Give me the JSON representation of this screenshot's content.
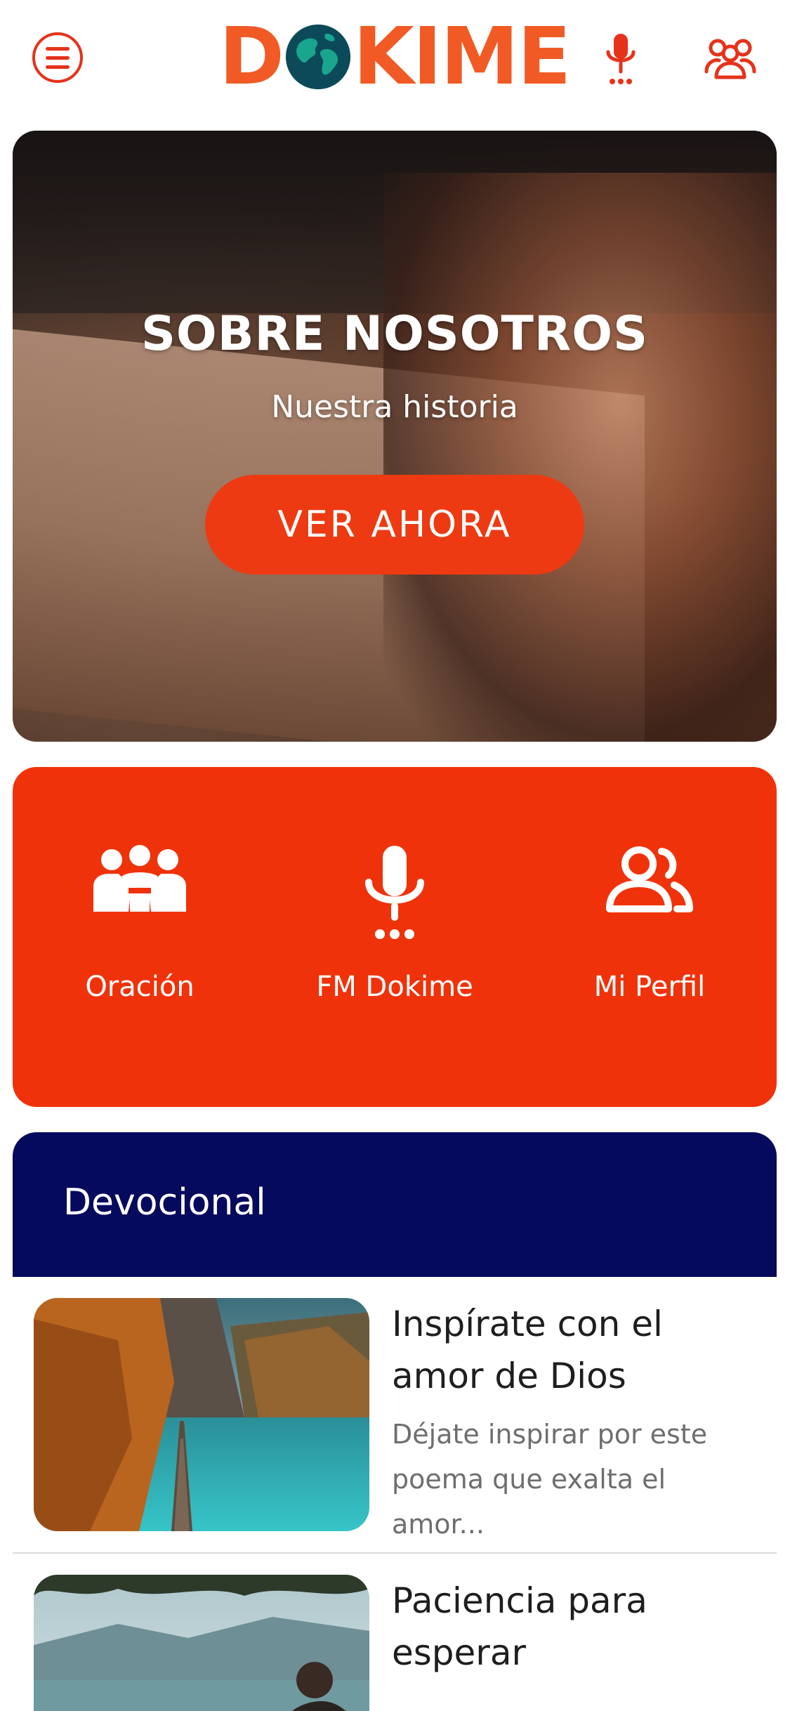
{
  "header": {
    "logo_text_left": "D",
    "logo_text_right": "KIME",
    "icons": [
      "menu-icon",
      "globe-icon",
      "microphone-icon",
      "group-icon"
    ]
  },
  "hero": {
    "title": "SOBRE NOSOTROS",
    "subtitle": "Nuestra historia",
    "button_label": "VER AHORA"
  },
  "quick_actions": [
    {
      "label": "Oración",
      "icon": "people-praying-icon"
    },
    {
      "label": "FM Dokime",
      "icon": "microphone-icon"
    },
    {
      "label": "Mi Perfil",
      "icon": "profile-icon"
    }
  ],
  "devotional": {
    "section_title": "Devocional",
    "articles": [
      {
        "title": "Inspírate con el amor de Dios",
        "excerpt": "Déjate inspirar por este poema que exalta el amor..."
      },
      {
        "title": "Paciencia para esperar",
        "excerpt": ""
      }
    ]
  },
  "colors": {
    "brand_orange": "#f15a24",
    "accent_red": "#f0320a",
    "navy": "#050a5c"
  }
}
